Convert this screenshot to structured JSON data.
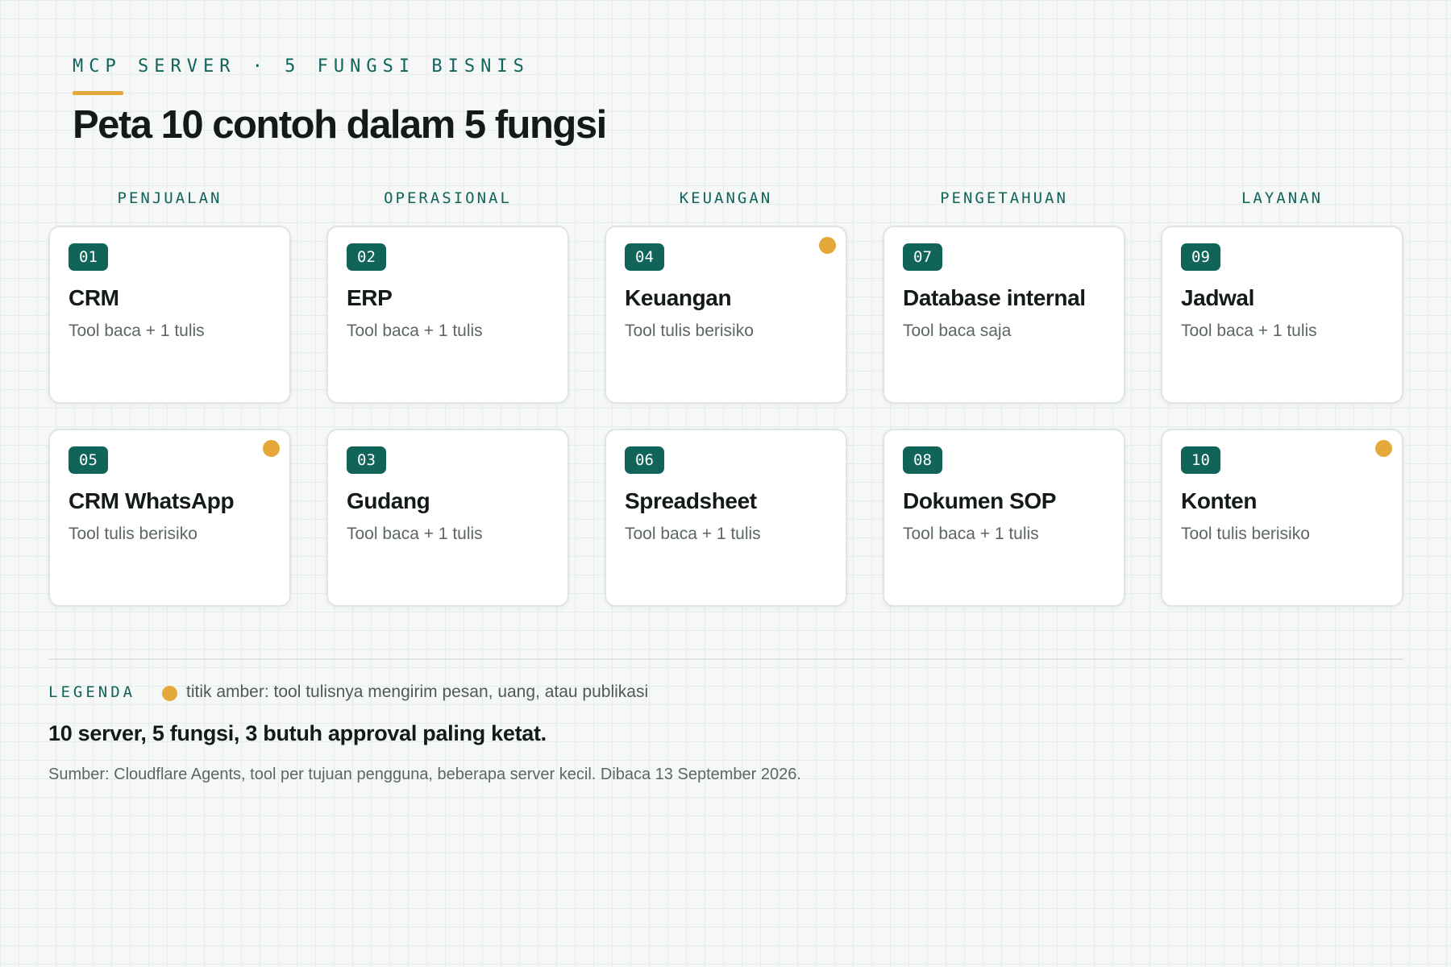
{
  "header": {
    "eyebrow": "MCP SERVER · 5 FUNGSI BISNIS",
    "title": "Peta 10 contoh dalam 5 fungsi"
  },
  "colors": {
    "accent": "#11645a",
    "amber": "#e5a93b"
  },
  "columns": [
    {
      "label": "PENJUALAN",
      "cards": [
        {
          "num": "01",
          "name": "CRM",
          "desc": "Tool baca + 1 tulis",
          "flag": false
        },
        {
          "num": "05",
          "name": "CRM WhatsApp",
          "desc": "Tool tulis berisiko",
          "flag": true
        }
      ]
    },
    {
      "label": "OPERASIONAL",
      "cards": [
        {
          "num": "02",
          "name": "ERP",
          "desc": "Tool baca + 1 tulis",
          "flag": false
        },
        {
          "num": "03",
          "name": "Gudang",
          "desc": "Tool baca + 1 tulis",
          "flag": false
        }
      ]
    },
    {
      "label": "KEUANGAN",
      "cards": [
        {
          "num": "04",
          "name": "Keuangan",
          "desc": "Tool tulis berisiko",
          "flag": true
        },
        {
          "num": "06",
          "name": "Spreadsheet",
          "desc": "Tool baca + 1 tulis",
          "flag": false
        }
      ]
    },
    {
      "label": "PENGETAHUAN",
      "cards": [
        {
          "num": "07",
          "name": "Database internal",
          "desc": "Tool baca saja",
          "flag": false
        },
        {
          "num": "08",
          "name": "Dokumen SOP",
          "desc": "Tool baca + 1 tulis",
          "flag": false
        }
      ]
    },
    {
      "label": "LAYANAN",
      "cards": [
        {
          "num": "09",
          "name": "Jadwal",
          "desc": "Tool baca + 1 tulis",
          "flag": false
        },
        {
          "num": "10",
          "name": "Konten",
          "desc": "Tool tulis berisiko",
          "flag": true
        }
      ]
    }
  ],
  "legend": {
    "label": "LEGENDA",
    "dot_text": "titik amber: tool tulisnya mengirim pesan, uang, atau publikasi"
  },
  "summary": "10 server, 5 fungsi, 3 butuh approval paling ketat.",
  "source": "Sumber: Cloudflare Agents, tool per tujuan pengguna, beberapa server kecil. Dibaca 13 September 2026."
}
